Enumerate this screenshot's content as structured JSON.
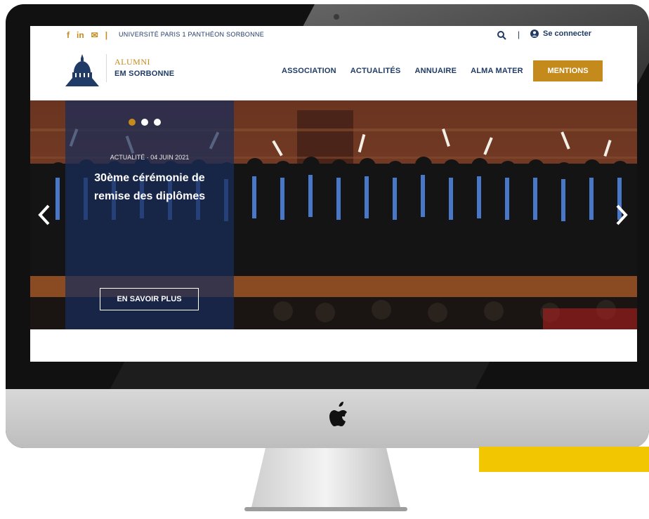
{
  "topbar": {
    "social": [
      "f",
      "in",
      "✉"
    ],
    "university": "UNIVERSITÉ PARIS 1 PANTHÉON SORBONNE",
    "login": "Se connecter"
  },
  "header": {
    "logo_top": "ALUMNI",
    "logo_bottom": "EM SORBONNE",
    "nav": [
      "ASSOCIATION",
      "ACTUALITÉS",
      "ANNUAIRE",
      "ALMA MATER"
    ],
    "cta": "MENTIONS"
  },
  "hero": {
    "kicker": "ACTUALITÉ · 04 JUIN 2021",
    "title": "30ème cérémonie de remise des diplômes",
    "button": "EN SAVOIR PLUS",
    "slides_total": 3,
    "active_slide": 1
  },
  "colors": {
    "navy": "#1f3b66",
    "gold": "#c48a1c",
    "accent_yellow": "#f2c600"
  }
}
